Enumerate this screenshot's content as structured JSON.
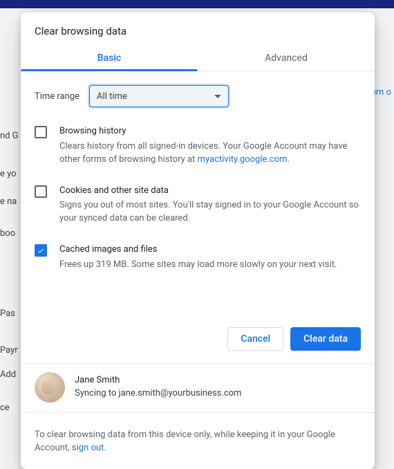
{
  "title": "Clear browsing data",
  "tabs": {
    "basic": "Basic",
    "advanced": "Advanced"
  },
  "timeRange": {
    "label": "Time range",
    "selected": "All time"
  },
  "options": [
    {
      "title": "Browsing history",
      "desc_pre": "Clears history from all signed-in devices. Your Google Account may have other forms of browsing history at ",
      "link": "myactivity.google.com",
      "desc_post": ".",
      "checked": false
    },
    {
      "title": "Cookies and other site data",
      "desc_pre": "Signs you out of most sites. You'll stay signed in to your Google Account so your synced data can be cleared.",
      "link": "",
      "desc_post": "",
      "checked": false
    },
    {
      "title": "Cached images and files",
      "desc_pre": "Frees up 319 MB. Some sites may load more slowly on your next visit.",
      "link": "",
      "desc_post": "",
      "checked": true
    }
  ],
  "buttons": {
    "cancel": "Cancel",
    "clear": "Clear data"
  },
  "account": {
    "name": "Jane Smith",
    "sync_prefix": "Syncing to  ",
    "email": "jane.smith@yourbusiness.com"
  },
  "footer": {
    "pre": "To clear browsing data from this device only, while keeping it in your Google Account, ",
    "link": "sign out",
    "post": "."
  },
  "bg": {
    "turn": "Turn o",
    "r1": "nd G",
    "r2": "e yo",
    "r3": "e na",
    "r4": "boo",
    "r5": "Pas",
    "r6": "Payr",
    "r7": "Add",
    "r8": "ce"
  }
}
